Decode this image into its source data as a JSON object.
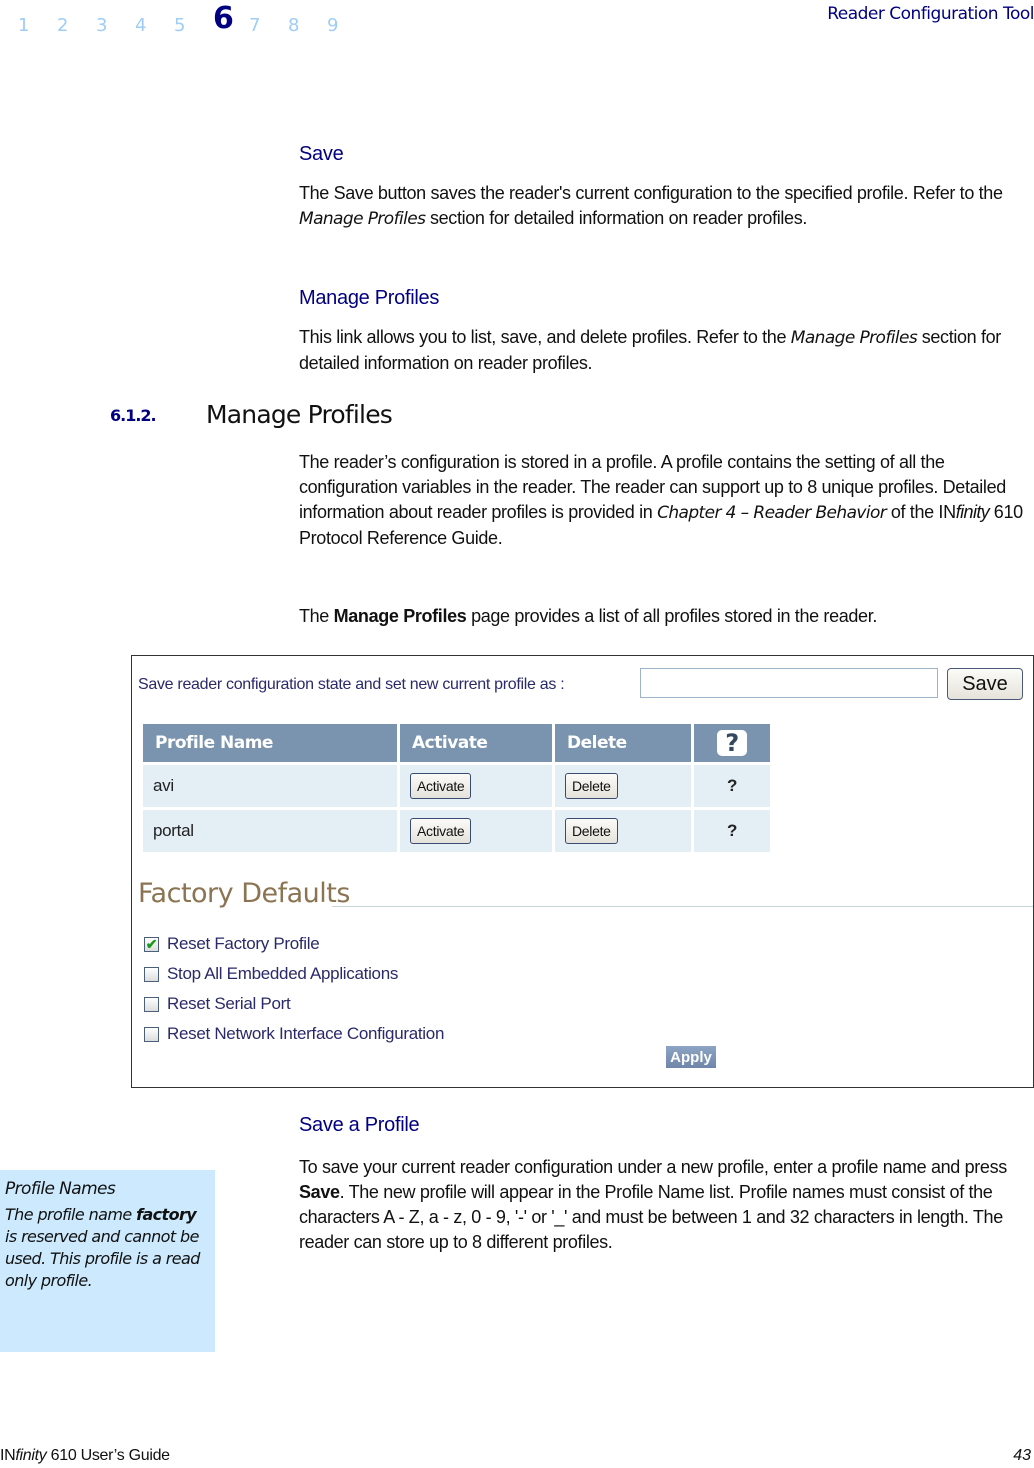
{
  "header": {
    "chapters": [
      "1",
      "2",
      "3",
      "4",
      "5",
      "6",
      "7",
      "8",
      "9"
    ],
    "active_chapter": "6",
    "running_title": "Reader Configuration Tool"
  },
  "save_section": {
    "heading": "Save",
    "text_1": "The Save button saves the reader's current configuration to the specified profile. Refer to the ",
    "text_italic": "Manage Profiles",
    "text_2": " section for detailed information on reader profiles."
  },
  "manage_link_section": {
    "heading": "Manage Profiles",
    "text_1": "This link allows you to list, save, and delete profiles. Refer to the ",
    "text_italic": "Manage Profiles",
    "text_2": " section for detailed information on reader profiles."
  },
  "section_612": {
    "number": "6.1.2.",
    "title": "Manage Profiles",
    "para1_1": "The reader’s configuration is stored in a profile. A profile contains the setting of all the configuration variables in the reader. The reader can support up to 8 unique profiles. Detailed information about reader profiles is provided in ",
    "para1_italic": "Chapter 4 – Reader Behavior",
    "para1_2": " of the IN",
    "para1_brand_italic": "finity",
    "para1_3": " 610 Protocol Reference Guide.",
    "para2_1": "The ",
    "para2_bold": "Manage Profiles",
    "para2_2": " page provides a list of all profiles stored in the reader."
  },
  "screenshot": {
    "save_label": "Save reader configuration state and set new current profile as :",
    "profile_input_value": "",
    "save_button": "Save",
    "table_headers": [
      "Profile Name",
      "Activate",
      "Delete",
      "?"
    ],
    "rows": [
      {
        "name": "avi",
        "activate": "Activate",
        "delete": "Delete",
        "help": "?"
      },
      {
        "name": "portal",
        "activate": "Activate",
        "delete": "Delete",
        "help": "?"
      }
    ],
    "factory_defaults_title": "Factory Defaults",
    "options": [
      {
        "label": "Reset Factory Profile",
        "checked": true
      },
      {
        "label": "Stop All Embedded Applications",
        "checked": false
      },
      {
        "label": "Reset Serial Port",
        "checked": false
      },
      {
        "label": "Reset Network Interface Configuration",
        "checked": false
      }
    ],
    "apply_button": "Apply",
    "check_glyph": "✔"
  },
  "save_profile_section": {
    "heading": "Save a Profile",
    "text_1": "To save your current reader configuration under a new profile, enter a profile name and press ",
    "text_bold": "Save",
    "text_2": ". The new profile will appear in the Profile Name list. Profile names must consist of the characters A - Z, a - z, 0 - 9, '-' or '_' and must be between 1 and 32 characters in length. The reader can store up to 8 different profiles."
  },
  "note": {
    "title": "Profile Names",
    "text_1": "The profile name ",
    "text_bold": "factory",
    "text_2": " is reserved and cannot be used. This profile is a read only profile."
  },
  "footer": {
    "brand_1": "IN",
    "brand_italic": "finity",
    "brand_2": " 610 User’s Guide",
    "page_number": "43"
  }
}
